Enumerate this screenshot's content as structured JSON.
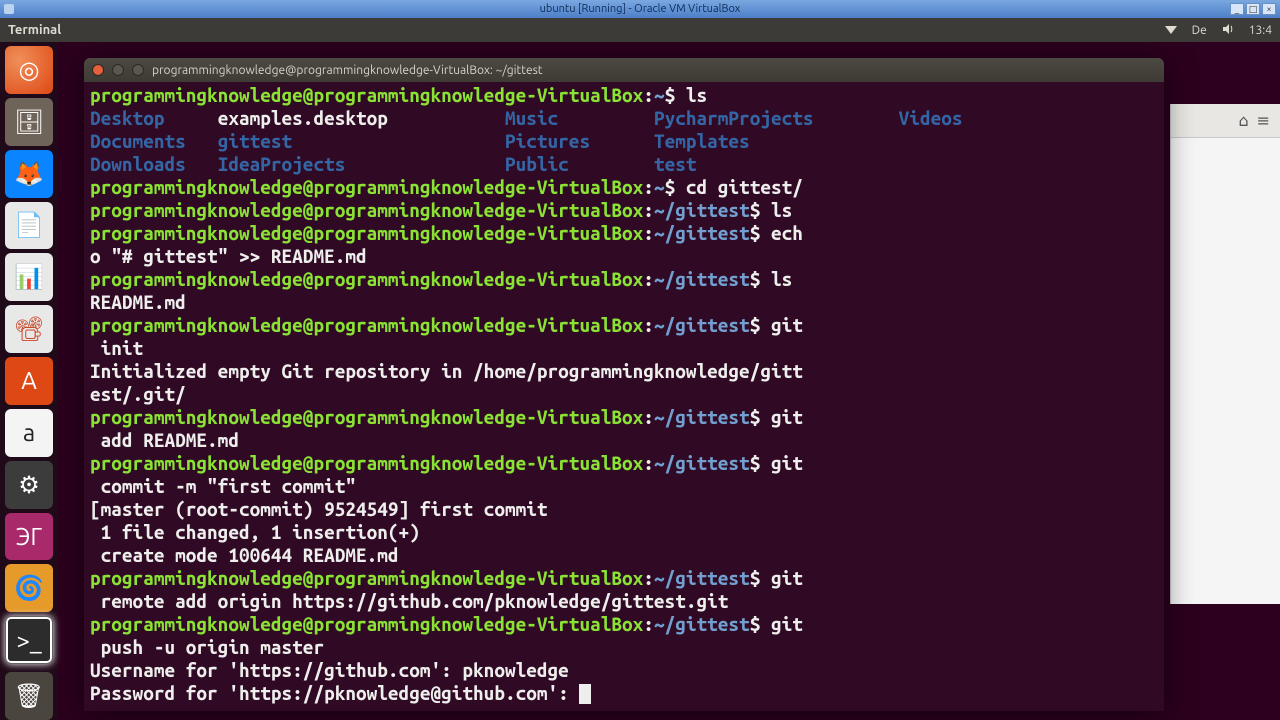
{
  "vbox": {
    "title": "ubuntu [Running] - Oracle VM VirtualBox"
  },
  "gnome": {
    "menu": "Terminal",
    "lang": "De",
    "clock": "13:4"
  },
  "launcher": {
    "items": [
      {
        "name": "dash",
        "glyph": "◎"
      },
      {
        "name": "files",
        "glyph": "🗄"
      },
      {
        "name": "firefox",
        "glyph": "🦊"
      },
      {
        "name": "writer",
        "glyph": "📄"
      },
      {
        "name": "calc",
        "glyph": "📊"
      },
      {
        "name": "impress",
        "glyph": "📽"
      },
      {
        "name": "software-center",
        "glyph": "A"
      },
      {
        "name": "amazon",
        "glyph": "a"
      },
      {
        "name": "settings",
        "glyph": "⚙"
      },
      {
        "name": "jt",
        "glyph": "ЭГ"
      },
      {
        "name": "cc",
        "glyph": "🌀"
      },
      {
        "name": "terminal",
        "glyph": ">_"
      }
    ],
    "trash_glyph": "🗑"
  },
  "terminal": {
    "title": "programmingknowledge@programmingknowledge-VirtualBox: ~/gittest",
    "prompt_user": "programmingknowledge@programmingknowledge-VirtualBox",
    "lines": {
      "l01_cmd": "ls",
      "ls_cols": {
        "c1": [
          "Desktop",
          "Documents",
          "Downloads"
        ],
        "c2_plain": "examples.desktop",
        "c2": [
          "gittest",
          "IdeaProjects"
        ],
        "c3": [
          "Music",
          "Pictures",
          "Public"
        ],
        "c4": [
          "PycharmProjects",
          "Templates",
          "test"
        ],
        "c5": [
          "Videos"
        ]
      },
      "l05_cmd": "cd gittest/",
      "l06_cmd": "ls",
      "l07_cmd_a": "ech",
      "l07_cmd_b": "o \"# gittest\" >> README.md",
      "l08_cmd": "ls",
      "l09_out": "README.md",
      "l10_cmd_a": "git",
      "l10_cmd_b": " init",
      "l11_out_a": "Initialized empty Git repository in /home/programmingknowledge/gitt",
      "l11_out_b": "est/.git/",
      "l12_cmd_a": "git",
      "l12_cmd_b": " add README.md",
      "l13_cmd_a": "git",
      "l13_cmd_b": " commit -m \"first commit\"",
      "l14_out": "[master (root-commit) 9524549] first commit",
      "l15_out": " 1 file changed, 1 insertion(+)",
      "l16_out": " create mode 100644 README.md",
      "l17_cmd_a": "git",
      "l17_cmd_b": " remote add origin https://github.com/pknowledge/gittest.git",
      "l18_cmd_a": "git",
      "l18_cmd_b": " push -u origin master",
      "l19_out": "Username for 'https://github.com': pknowledge",
      "l20_out": "Password for 'https://pknowledge@github.com': "
    }
  },
  "bgwin": {
    "home_glyph": "⌂",
    "menu_glyph": "≡"
  }
}
